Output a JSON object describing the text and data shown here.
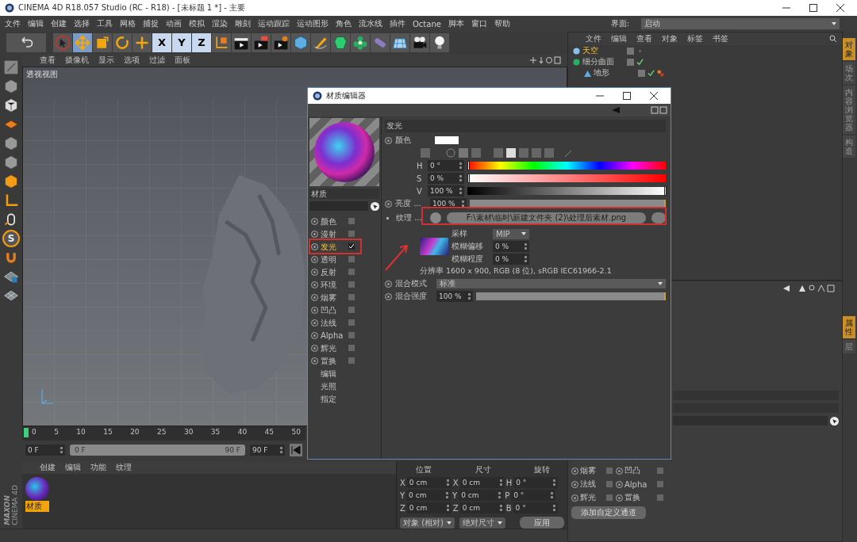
{
  "window": {
    "title": "CINEMA 4D R18.057 Studio (RC - R18) - [未标题 1 *] - 主要"
  },
  "menu": [
    "文件",
    "编辑",
    "创建",
    "选择",
    "工具",
    "网格",
    "捕捉",
    "动画",
    "模拟",
    "渲染",
    "雕刻",
    "运动跟踪",
    "运动图形",
    "角色",
    "流水线",
    "插件",
    "Octane",
    "脚本",
    "窗口",
    "帮助"
  ],
  "layout_selector": {
    "label": "界面:",
    "value": "启动"
  },
  "toolbar": {
    "tools": [
      {
        "kind": "undo",
        "selected": false
      },
      {
        "kind": "select",
        "selected": false
      },
      {
        "kind": "move",
        "selected": true
      },
      {
        "kind": "scale",
        "selected": false
      },
      {
        "kind": "rotate",
        "selected": false
      },
      {
        "kind": "add",
        "selected": false
      }
    ],
    "axes": [
      {
        "label": "X",
        "selected": true
      },
      {
        "label": "Y",
        "selected": true
      },
      {
        "label": "Z",
        "selected": true
      }
    ],
    "objects": [
      {
        "kind": "coords"
      },
      {
        "kind": "render-view"
      },
      {
        "kind": "render"
      },
      {
        "kind": "render-settings"
      },
      {
        "kind": "cube"
      },
      {
        "kind": "pen"
      },
      {
        "kind": "subdivision"
      },
      {
        "kind": "cloner"
      },
      {
        "kind": "deformer"
      },
      {
        "kind": "floor"
      },
      {
        "kind": "camera"
      },
      {
        "kind": "light"
      }
    ]
  },
  "left_tools": [
    {
      "kind": "editable"
    },
    {
      "kind": "model"
    },
    {
      "kind": "texture"
    },
    {
      "kind": "workplane"
    },
    {
      "kind": "points"
    },
    {
      "kind": "edges"
    },
    {
      "kind": "polygons"
    },
    {
      "kind": "axis"
    },
    {
      "kind": "tweak"
    },
    {
      "kind": "snap",
      "label": "S"
    },
    {
      "kind": "magnet"
    },
    {
      "kind": "lock"
    },
    {
      "kind": "grid"
    }
  ],
  "viewport": {
    "menu": [
      "查看",
      "摄像机",
      "显示",
      "选项",
      "过滤",
      "面板"
    ],
    "title": "透视视图"
  },
  "timeline": {
    "ticks": [
      "0",
      "5",
      "10",
      "15",
      "20",
      "25",
      "30",
      "35",
      "40",
      "45",
      "50"
    ],
    "playhead": {
      "level": 0
    },
    "range": {
      "level": 1
    },
    "start": "0 F",
    "range_start": "0 F",
    "range_end": "90 F",
    "end": "90 F"
  },
  "material_manager": {
    "menu": [
      "创建",
      "编辑",
      "功能",
      "纹理"
    ],
    "materials": [
      {
        "name": "材质",
        "selected": true
      }
    ]
  },
  "brand": {
    "maker": "MAXON",
    "product": "CINEMA 4D"
  },
  "coordinates": {
    "headers": [
      "位置",
      "尺寸",
      "旋转"
    ],
    "rows": [
      {
        "pos_axis": "X",
        "pos": "0 cm",
        "size_axis": "X",
        "size": "0 cm",
        "rot_axis": "H",
        "rot": "0 °"
      },
      {
        "pos_axis": "Y",
        "pos": "0 cm",
        "size_axis": "Y",
        "size": "0 cm",
        "rot_axis": "P",
        "rot": "0 °"
      },
      {
        "pos_axis": "Z",
        "pos": "0 cm",
        "size_axis": "Z",
        "size": "0 cm",
        "rot_axis": "B",
        "rot": "0 °"
      }
    ],
    "mode": "对象 (相对)",
    "size_mode": "绝对尺寸",
    "apply": "应用"
  },
  "object_manager": {
    "menu": [
      "文件",
      "编辑",
      "查看",
      "对象",
      "标签",
      "书签"
    ],
    "tree": [
      {
        "name": "天空",
        "kind": "sky",
        "selected": true,
        "enabled": false,
        "tagged": false
      },
      {
        "name": "细分曲面",
        "kind": "subdivision",
        "selected": false,
        "enabled": true,
        "tagged": false,
        "children": [
          {
            "name": "地形",
            "kind": "landscape",
            "selected": false,
            "enabled": true,
            "tagged": true
          }
        ]
      }
    ]
  },
  "side_tabs": [
    {
      "label": "对象",
      "selected": true
    },
    {
      "label": "场次",
      "selected": false
    },
    {
      "label": "内容浏览器",
      "selected": false
    },
    {
      "label": "构造",
      "selected": false
    }
  ],
  "lower_tabs": [
    {
      "label": "属性",
      "selected": true
    },
    {
      "label": "层",
      "selected": false
    }
  ],
  "attributes": {
    "channels": [
      {
        "name": "烟雾",
        "checked": false
      },
      {
        "name": "凹凸",
        "checked": false
      },
      {
        "name": "法线",
        "checked": false
      },
      {
        "name": "Alpha",
        "checked": false
      },
      {
        "name": "辉光",
        "checked": false
      },
      {
        "name": "置换",
        "checked": false
      }
    ],
    "add_button": "添加自定义通道"
  },
  "material_editor": {
    "title": "材质编辑器",
    "material_name": "材质",
    "channels": [
      {
        "kind": "channel",
        "name": "颜色",
        "checked": false,
        "selected": false
      },
      {
        "kind": "channel",
        "name": "漫射",
        "checked": false,
        "selected": false
      },
      {
        "kind": "channel",
        "name": "发光",
        "checked": true,
        "selected": true
      },
      {
        "kind": "channel",
        "name": "透明",
        "checked": false,
        "selected": false
      },
      {
        "kind": "channel",
        "name": "反射",
        "checked": false,
        "selected": false
      },
      {
        "kind": "channel",
        "name": "环境",
        "checked": false,
        "selected": false
      },
      {
        "kind": "channel",
        "name": "烟雾",
        "checked": false,
        "selected": false
      },
      {
        "kind": "channel",
        "name": "凹凸",
        "checked": false,
        "selected": false
      },
      {
        "kind": "channel",
        "name": "法线",
        "checked": false,
        "selected": false
      },
      {
        "kind": "channel",
        "name": "Alpha",
        "checked": false,
        "selected": false
      },
      {
        "kind": "channel",
        "name": "辉光",
        "checked": false,
        "selected": false
      },
      {
        "kind": "channel",
        "name": "置换",
        "checked": false,
        "selected": false
      },
      {
        "kind": "page",
        "name": "编辑",
        "selected": false
      },
      {
        "kind": "page",
        "name": "光照",
        "selected": false
      },
      {
        "kind": "page",
        "name": "指定",
        "selected": false
      }
    ],
    "section": "发光",
    "color": {
      "label": "颜色"
    },
    "hsv": [
      {
        "label": "H",
        "value": "0 °",
        "level": 0
      },
      {
        "label": "S",
        "value": "0 %",
        "level": 0
      },
      {
        "label": "V",
        "value": "100 %",
        "level": 1
      }
    ],
    "brightness": {
      "label": "亮度 ...",
      "value": "100 %",
      "level": 1
    },
    "texture": {
      "label": "纹理 ...",
      "path": "F:\\素材\\临时\\新建文件夹 (2)\\处理后素材.png"
    },
    "sampling": {
      "label": "采样",
      "value": "MIP"
    },
    "blur_offset": {
      "label": "模糊偏移",
      "value": "0 %"
    },
    "blur_scale": {
      "label": "模糊程度",
      "value": "0 %"
    },
    "resolution": "分辨率 1600 x 900, RGB (8 位), sRGB IEC61966-2.1",
    "mix_mode": {
      "label": "混合模式",
      "value": "标准"
    },
    "mix_strength": {
      "label": "混合强度",
      "value": "100 %",
      "level": 1
    }
  }
}
